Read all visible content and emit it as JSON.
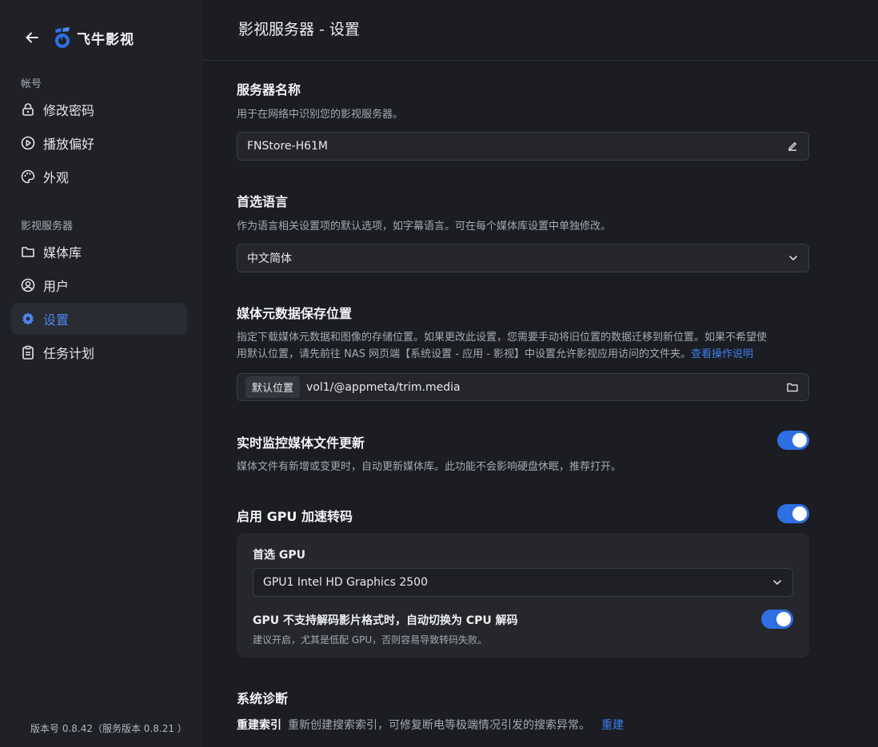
{
  "app": {
    "name": "飞牛影视",
    "page_title": "影视服务器 - 设置"
  },
  "sidebar": {
    "account_section": "帐号",
    "account_items": [
      {
        "label": "修改密码",
        "icon": "lock-icon"
      },
      {
        "label": "播放偏好",
        "icon": "play-circle-icon"
      },
      {
        "label": "外观",
        "icon": "palette-icon"
      }
    ],
    "server_section": "影视服务器",
    "server_items": [
      {
        "label": "媒体库",
        "icon": "folder-icon"
      },
      {
        "label": "用户",
        "icon": "user-circle-icon"
      },
      {
        "label": "设置",
        "icon": "gear-icon",
        "active": true
      },
      {
        "label": "任务计划",
        "icon": "clipboard-icon"
      }
    ],
    "version": "版本号 0.8.42（服务版本 0.8.21 ）"
  },
  "server_name": {
    "title": "服务器名称",
    "desc": "用于在网络中识别您的影视服务器。",
    "value": "FNStore-H61M"
  },
  "language": {
    "title": "首选语言",
    "desc": "作为语言相关设置项的默认选项，如字幕语言。可在每个媒体库设置中单独修改。",
    "value": "中文简体"
  },
  "metadata": {
    "title": "媒体元数据保存位置",
    "desc_line1": "指定下载媒体元数据和图像的存储位置。如果更改此设置，您需要手动将旧位置的数据迁移到新位置。如果不希望使",
    "desc_line2": "用默认位置，请先前往 NAS 网页端【系统设置 - 应用 - 影视】中设置允许影视应用访问的文件夹。",
    "help_link": "查看操作说明",
    "tag": "默认位置",
    "path": "vol1/@appmeta/trim.media"
  },
  "realtime_monitor": {
    "title": "实时监控媒体文件更新",
    "desc": "媒体文件有新增或变更时，自动更新媒体库。此功能不会影响硬盘休眠，推荐打开。",
    "enabled": true
  },
  "gpu": {
    "title": "启用 GPU 加速转码",
    "enabled": true,
    "preferred_label": "首选 GPU",
    "preferred_value": "GPU1 Intel HD Graphics 2500",
    "fallback_label": "GPU 不支持解码影片格式时，自动切换为 CPU 解码",
    "fallback_desc": "建议开启，尤其是低配 GPU，否则容易导致转码失败。",
    "fallback_enabled": true
  },
  "diagnostics": {
    "title": "系统诊断",
    "rebuild_label": "重建索引",
    "rebuild_desc": "重新创建搜索索引，可修复断电等极端情况引发的搜索异常。",
    "rebuild_link": "重建"
  },
  "colors": {
    "accent": "#2f6fe4",
    "link": "#3d7ff0",
    "sidebar_bg": "#1f2126",
    "main_bg": "#1b1d22"
  }
}
